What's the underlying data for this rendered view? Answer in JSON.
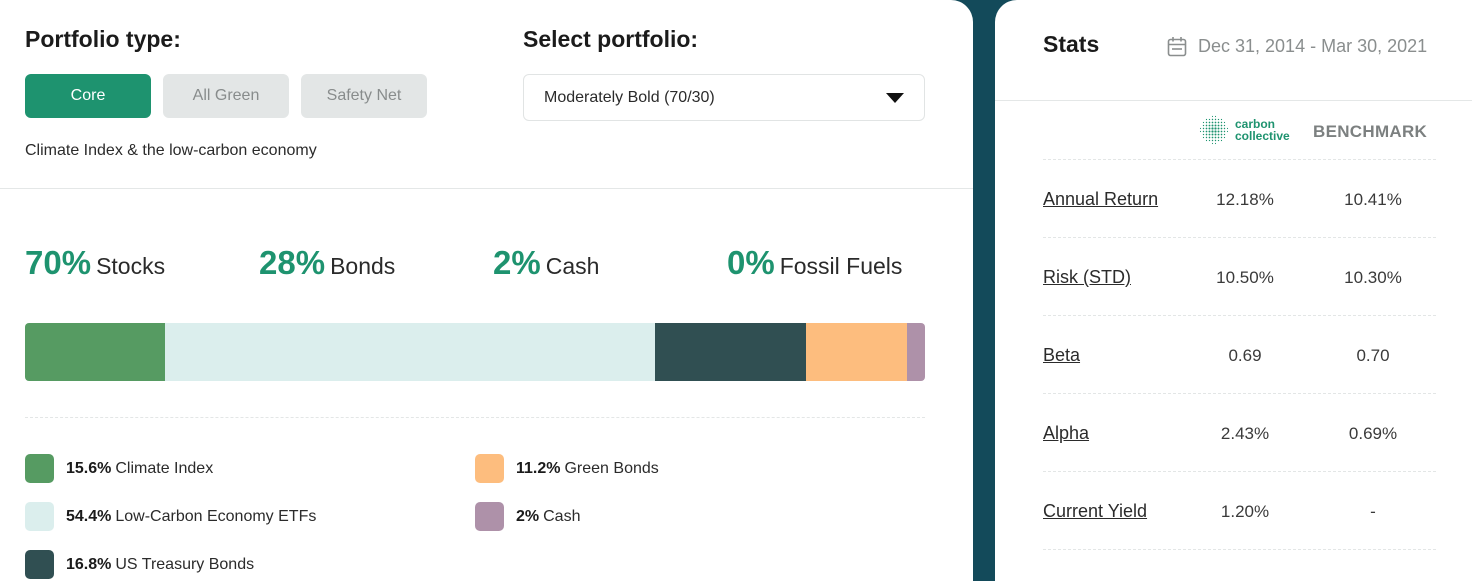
{
  "portfolio_type": {
    "heading": "Portfolio type:",
    "options": [
      {
        "label": "Core",
        "active": true
      },
      {
        "label": "All Green",
        "active": false
      },
      {
        "label": "Safety Net",
        "active": false
      }
    ],
    "description": "Climate Index & the low-carbon economy"
  },
  "select_portfolio": {
    "heading": "Select portfolio:",
    "selected": "Moderately Bold (70/30)"
  },
  "allocation": [
    {
      "pct": "70%",
      "label": "Stocks"
    },
    {
      "pct": "28%",
      "label": "Bonds"
    },
    {
      "pct": "2%",
      "label": "Cash"
    },
    {
      "pct": "0%",
      "label": "Fossil Fuels"
    }
  ],
  "breakdown": [
    {
      "pct": "15.6%",
      "label": "Climate Index",
      "value": 15.6,
      "color": "#569b62"
    },
    {
      "pct": "54.4%",
      "label": "Low-Carbon Economy ETFs",
      "value": 54.4,
      "color": "#dbeeed"
    },
    {
      "pct": "16.8%",
      "label": "US Treasury Bonds",
      "value": 16.8,
      "color": "#304f52"
    },
    {
      "pct": "11.2%",
      "label": "Green Bonds",
      "value": 11.2,
      "color": "#fdbd7e"
    },
    {
      "pct": "2%",
      "label": "Cash",
      "value": 2,
      "color": "#ae91a9"
    }
  ],
  "stats": {
    "title": "Stats",
    "date_range": "Dec 31, 2014 - Mar 30, 2021",
    "brand_line1": "carbon",
    "brand_line2": "collective",
    "benchmark_label": "BENCHMARK",
    "rows": [
      {
        "label": "Annual Return",
        "cc": "12.18%",
        "bm": "10.41%"
      },
      {
        "label": "Risk (STD)",
        "cc": "10.50%",
        "bm": "10.30%"
      },
      {
        "label": "Beta",
        "cc": "0.69",
        "bm": "0.70"
      },
      {
        "label": "Alpha",
        "cc": "2.43%",
        "bm": "0.69%"
      },
      {
        "label": "Current Yield",
        "cc": "1.20%",
        "bm": "-"
      }
    ]
  },
  "colors": {
    "accent": "#1e936f",
    "divider_background": "#134a5a"
  }
}
